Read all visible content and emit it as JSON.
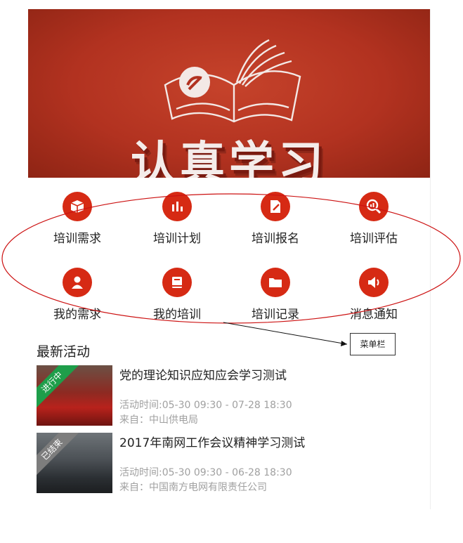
{
  "banner": {
    "title": "认真学习"
  },
  "menu": {
    "items": [
      {
        "label": "培训需求",
        "icon": "box-icon"
      },
      {
        "label": "培训计划",
        "icon": "bar-chart-icon"
      },
      {
        "label": "培训报名",
        "icon": "edit-document-icon"
      },
      {
        "label": "培训评估",
        "icon": "magnify-chart-icon"
      },
      {
        "label": "我的需求",
        "icon": "user-icon"
      },
      {
        "label": "我的培训",
        "icon": "book-icon"
      },
      {
        "label": "培训记录",
        "icon": "folder-icon"
      },
      {
        "label": "消息通知",
        "icon": "speaker-icon"
      }
    ]
  },
  "section": {
    "title": "最新活动"
  },
  "activities": [
    {
      "status": "进行中",
      "title": "党的理论知识应知应会学习测试",
      "time": "活动时间:05-30 09:30 - 07-28 18:30",
      "from": "来自：中山供电局"
    },
    {
      "status": "已结束",
      "title": "2017年南网工作会议精神学习测试",
      "time": "活动时间:05-30 09:30 - 06-28 18:30",
      "from": "来自：中国南方电网有限责任公司"
    }
  ],
  "annotation": {
    "callout_label": "菜单栏"
  },
  "colors": {
    "accent": "#d62a14",
    "banner": "#b23220",
    "status_active": "#1e9e4a",
    "status_ended": "#7d7d7d"
  }
}
